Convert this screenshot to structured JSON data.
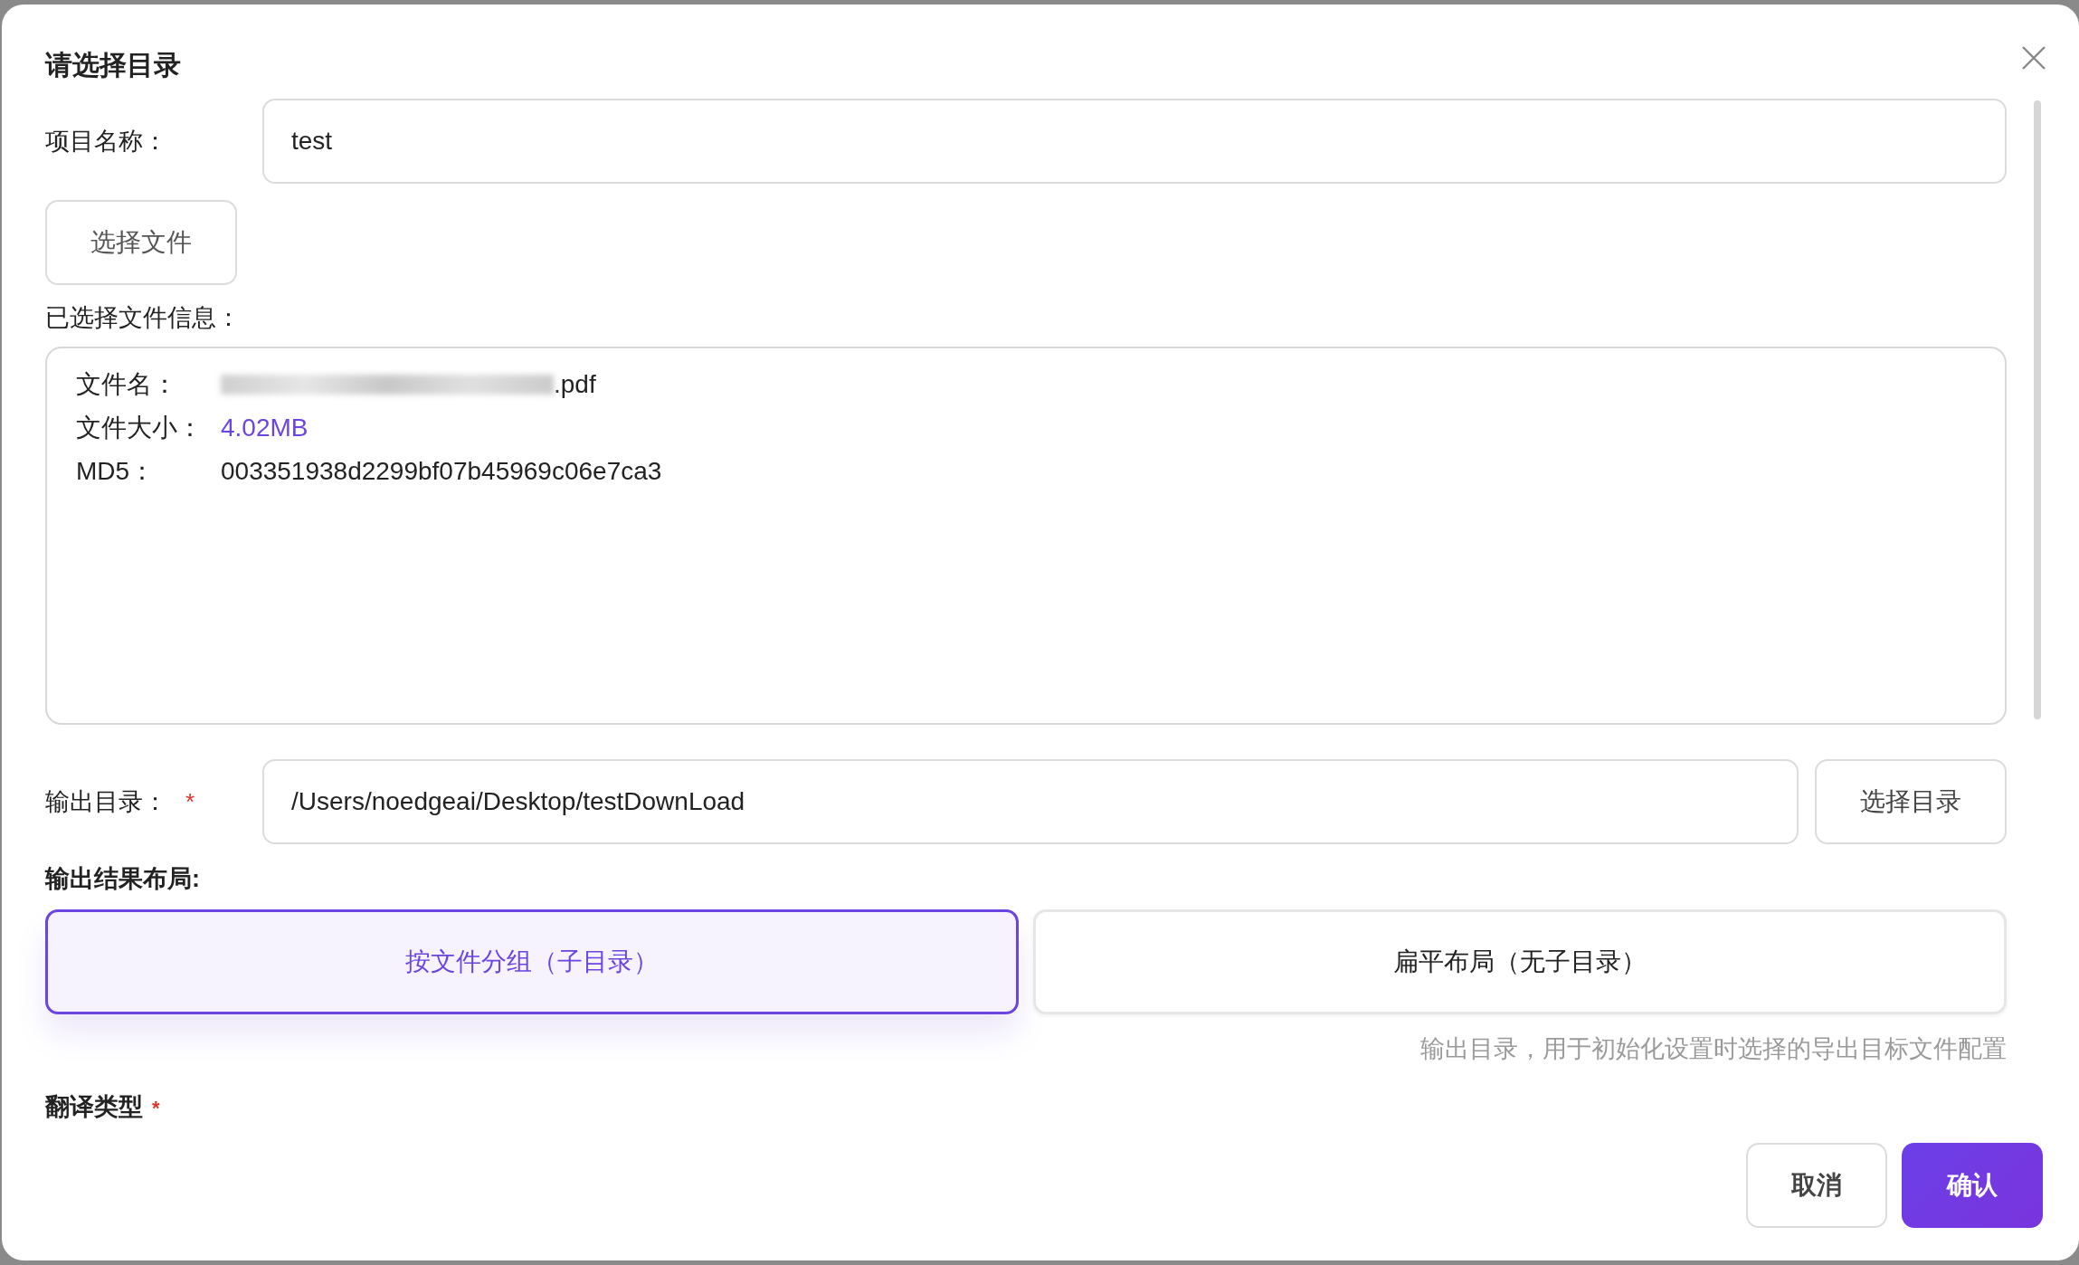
{
  "dialog": {
    "title": "请选择目录"
  },
  "project_name": {
    "label": "项目名称：",
    "value": "test"
  },
  "select_file_button": "选择文件",
  "file_info": {
    "label": "已选择文件信息：",
    "rows": [
      {
        "label": "文件名：",
        "value": ".pdf",
        "kind": "redacted"
      },
      {
        "label": "文件大小：",
        "value": "4.02MB",
        "kind": "accent"
      },
      {
        "label": "MD5：",
        "value": "003351938d2299bf07b45969c06e7ca3",
        "kind": "text"
      }
    ]
  },
  "output_dir": {
    "label": "输出目录：",
    "required": true,
    "required_mark": "*",
    "value": "/Users/noedgeai/Desktop/testDownLoad",
    "button": "选择目录"
  },
  "layout": {
    "label": "输出结果布局:",
    "options": [
      {
        "label": "按文件分组（子目录）",
        "selected": true
      },
      {
        "label": "扁平布局（无子目录）",
        "selected": false
      }
    ],
    "hint": "输出目录，用于初始化设置时选择的导出目标文件配置"
  },
  "translation_type": {
    "label": "翻译类型",
    "required": true,
    "required_mark": "*"
  },
  "footer_buttons": [
    {
      "label": "取消",
      "kind": "secondary"
    },
    {
      "label": "确认",
      "kind": "primary"
    }
  ]
}
